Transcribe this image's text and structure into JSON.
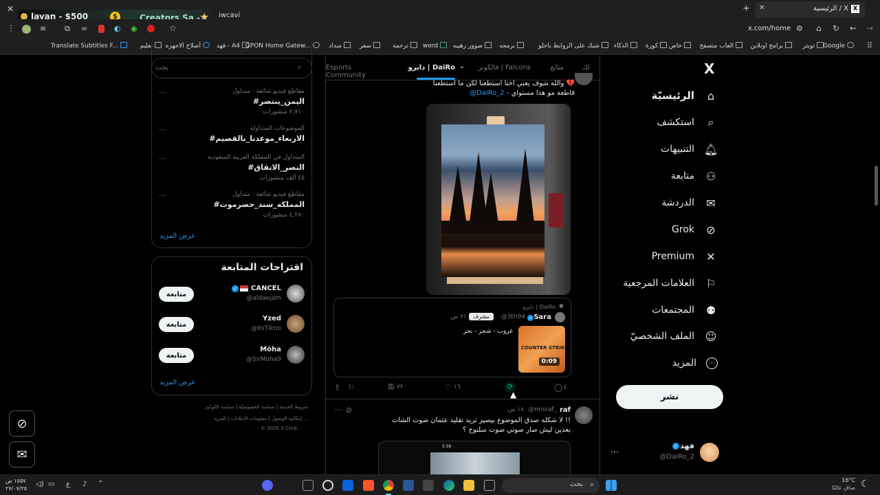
{
  "browser": {
    "tab_title": "الرئيسية / X",
    "overlay_left": "layan - $500",
    "overlay_mid": "Creators Sa -",
    "overlay_right": "iwcavi",
    "url": "x.com/home",
    "bookmarks": [
      "Google",
      "تويتر",
      "برامج اونلاين",
      "العاب متصفح",
      "خاص",
      "كورة",
      "الذكاء",
      "شيك على الروابط ياحلو",
      "برمجه",
      "صوور رهيبه",
      "word",
      "ترجمة",
      "سفر",
      "سداد",
      "GPON Home Gatew...",
      "فهد - A4",
      "أصلاح الاجهزه",
      "تعليم",
      "Translate Subtitles F..."
    ]
  },
  "nav": {
    "logo": "X",
    "items": [
      {
        "label": "الرئيسيّة",
        "icon": "home-icon",
        "glyph": "⌂"
      },
      {
        "label": "استكشف",
        "icon": "search-icon",
        "glyph": "⌕"
      },
      {
        "label": "التنبيهات",
        "icon": "bell-icon",
        "glyph": "♫"
      },
      {
        "label": "متابعة",
        "icon": "person-add-icon",
        "glyph": "⚇"
      },
      {
        "label": "الدردشة",
        "icon": "envelope-icon",
        "glyph": "✉"
      },
      {
        "label": "Grok",
        "icon": "grok-icon",
        "glyph": "⊘"
      },
      {
        "label": "Premium",
        "icon": "x-icon",
        "glyph": "✕"
      },
      {
        "label": "العلامات المرجعية",
        "icon": "bookmark-icon",
        "glyph": "⚐"
      },
      {
        "label": "المجتمعات",
        "icon": "communities-icon",
        "glyph": "⚉"
      },
      {
        "label": "الملف الشخصيّ",
        "icon": "profile-icon",
        "glyph": "☺"
      },
      {
        "label": "المزيد",
        "icon": "more-circle-icon",
        "glyph": "⋯"
      }
    ],
    "post_button": "نشر",
    "account_name": "فهد",
    "account_handle": "@DaiRo_2"
  },
  "tabs": [
    "لك",
    "متابَع",
    "فالكونز | Falcons",
    "دايرو | DaiRo",
    "Esports Community"
  ],
  "tweet1": {
    "text_line1": "والله شوف يعني احنا استطعنا لكن ما استطعنا 💔",
    "text_line2_mention": "@DaiRo_2",
    "text_line2_rest": " - قاطعة مو هذا مستواي",
    "quote": {
      "community": "دايرو | DaiRo",
      "name": "Sara",
      "handle": "@3th94",
      "badge": "مشرف",
      "time": "٢١ س",
      "text": "غروب - شجر - بحر",
      "video_duration": "0:09",
      "thumb_label": "COUNTER STRIKE"
    },
    "stats": {
      "replies": "٤",
      "likes": "١٦",
      "views": "٧٢٠"
    }
  },
  "tweet2": {
    "name": "raf",
    "handle": "@misraf_",
    "time": "١٨ س",
    "line1": "لا شكله صدق الموضوع بيصير تريد تقليد عثمان صوت الشات !!",
    "line2": "بعدين ليش صار صوتي صوت سلتوح ؟",
    "phone_time": "5:56"
  },
  "search": {
    "placeholder": "بحث"
  },
  "trends": [
    {
      "meta": "مقاطع فيديو شائعة · متداول",
      "tag": "#اليمن_ينتصر",
      "count": "٢,٧١٠ منشورات"
    },
    {
      "meta": "الموضوعات المتداولة",
      "tag": "#الاربعاء_موعدنا_بالقصيم",
      "count": ""
    },
    {
      "meta": "المتداول في المملكة العربية السعودية",
      "tag": "#النصر_الاتفاق",
      "count": "٤٥ ألف منشورات"
    },
    {
      "meta": "مقاطع فيديو شائعة · متداول",
      "tag": "#المملكه_سند_حضرموت",
      "count": "٤,٢٨٠ منشورات"
    }
  ],
  "show_more": "عرض المزيد",
  "who_to_follow": {
    "title": "اقتراحات المتابعة",
    "follow_label": "متابعة",
    "users": [
      {
        "name": "CANCEL",
        "handle": "@aldaejam"
      },
      {
        "name": "Yzed",
        "handle": "@itsTikno"
      },
      {
        "name": "Möha",
        "handle": "@SirMoha9"
      }
    ],
    "show_more": "عرض المزيد"
  },
  "footer": {
    "line1": [
      "شروط الخدمة",
      "سياسة الخصوصيّة",
      "سياسة الكوكيز"
    ],
    "line2": [
      "إمكانية الوصول",
      "معلومات الإعلانات",
      "المزيد ..."
    ],
    "copyright": "© 2025 X Corp."
  },
  "taskbar": {
    "search_placeholder": "بحث",
    "clock_time": "١٥٥٧ ص",
    "clock_date": "٢٧/٠٧/٢٥",
    "lang": "ع",
    "weather_temp": "16°C",
    "weather_desc": "صافٍ غالبًا"
  }
}
